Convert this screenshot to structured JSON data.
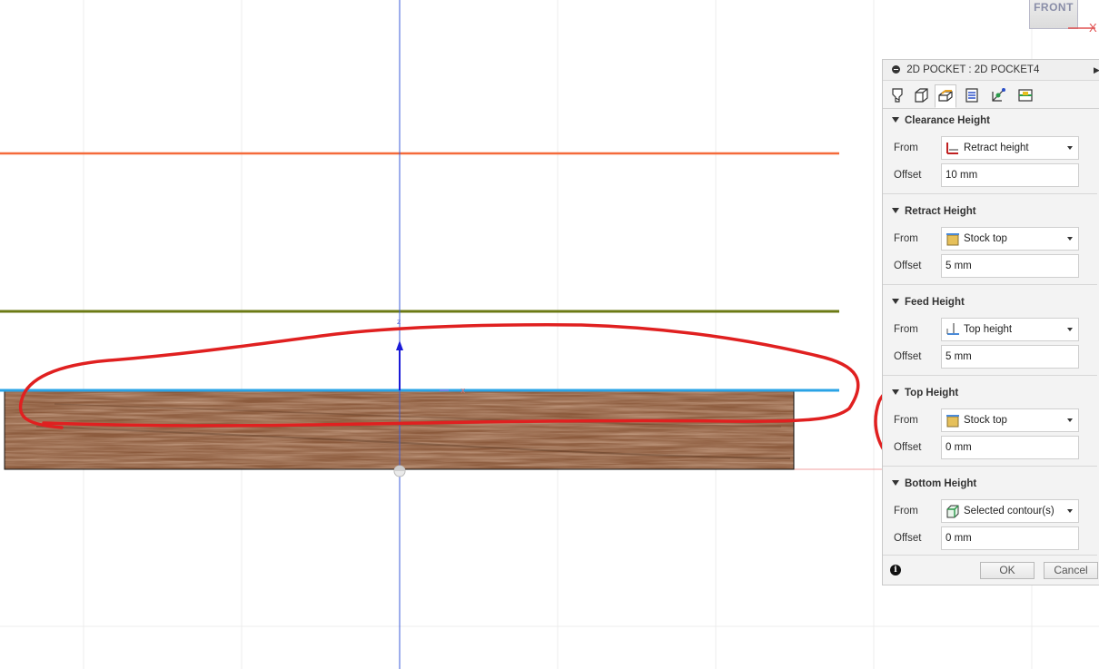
{
  "viewcube": {
    "face_label": "FRONT",
    "axis_label": "X"
  },
  "colors": {
    "clearance_line": "#f56a3a",
    "retract_line": "#6b7a14",
    "top_line": "#2aa3e6",
    "axis_blue": "#3b5bd8",
    "annotation_red": "#e02020",
    "wood_base": "#8b5a3c"
  },
  "panel": {
    "title": "2D POCKET : 2D POCKET4",
    "tabs": [
      {
        "name": "tool-tab-icon"
      },
      {
        "name": "geometry-tab-icon"
      },
      {
        "name": "heights-tab-icon"
      },
      {
        "name": "passes-tab-icon"
      },
      {
        "name": "linking-tab-icon"
      },
      {
        "name": "shape-tab-icon"
      }
    ],
    "sections": [
      {
        "title": "Clearance Height",
        "from_label": "From",
        "from_value": "Retract height",
        "from_icon": "retract-height-icon",
        "offset_label": "Offset",
        "offset_value": "10 mm"
      },
      {
        "title": "Retract Height",
        "from_label": "From",
        "from_value": "Stock top",
        "from_icon": "stock-top-icon",
        "offset_label": "Offset",
        "offset_value": "5 mm"
      },
      {
        "title": "Feed Height",
        "from_label": "From",
        "from_value": "Top height",
        "from_icon": "top-height-icon",
        "offset_label": "Offset",
        "offset_value": "5 mm"
      },
      {
        "title": "Top Height",
        "from_label": "From",
        "from_value": "Stock top",
        "from_icon": "stock-top-icon",
        "offset_label": "Offset",
        "offset_value": "0 mm"
      },
      {
        "title": "Bottom Height",
        "from_label": "From",
        "from_value": "Selected contour(s)",
        "from_icon": "selected-contour-icon",
        "offset_label": "Offset",
        "offset_value": "0 mm"
      }
    ],
    "ok_label": "OK",
    "cancel_label": "Cancel"
  }
}
